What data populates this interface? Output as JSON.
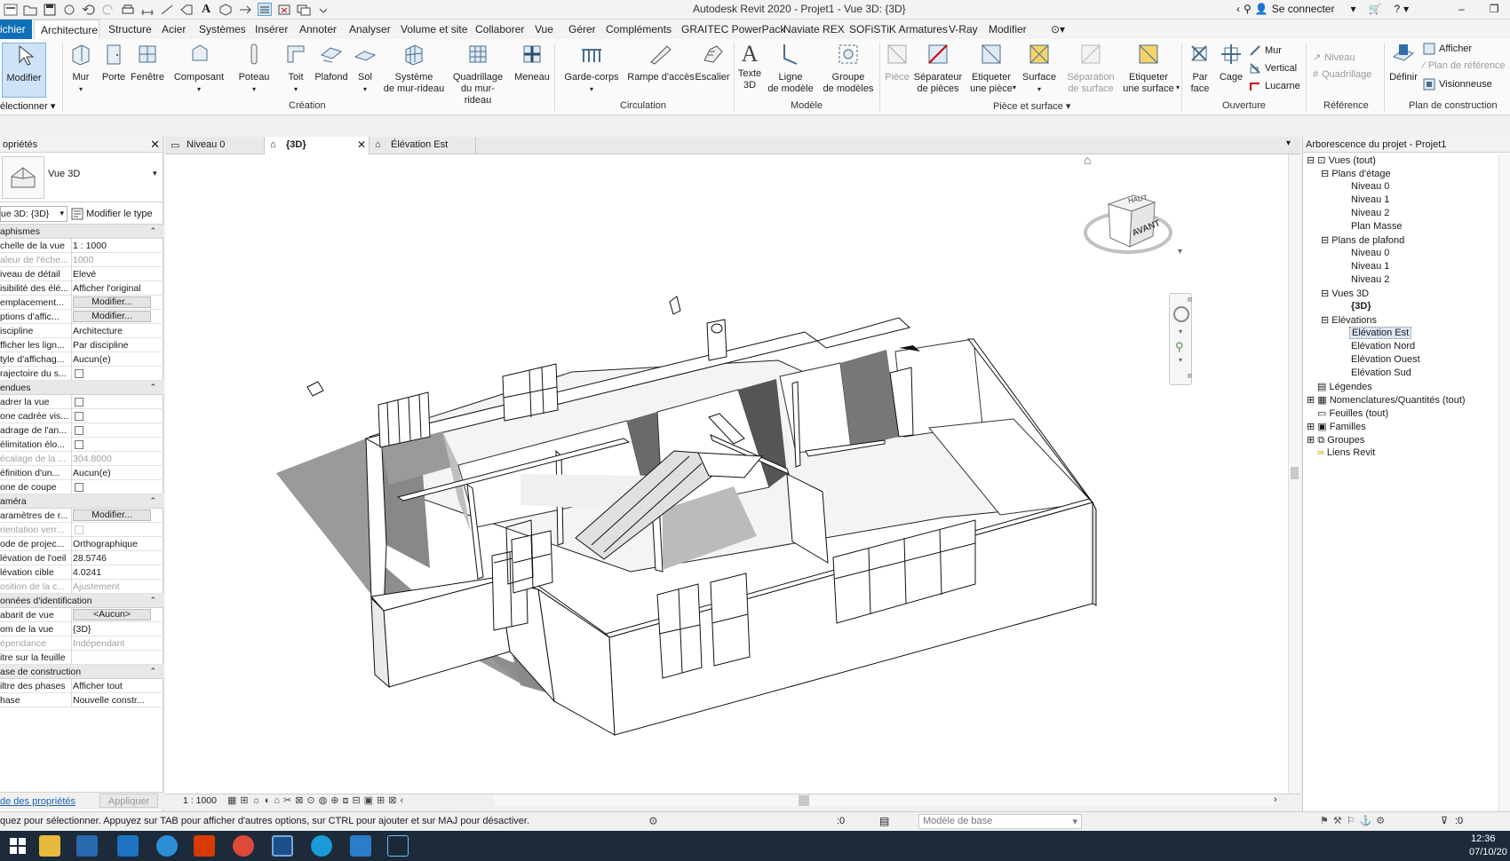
{
  "window": {
    "title": "Autodesk Revit 2020 - Projet1 - Vue 3D: {3D}",
    "connect": "Se connecter"
  },
  "menu": {
    "fichier": "ichier",
    "tabs": [
      "Architecture",
      "Structure",
      "Acier",
      "Systèmes",
      "Insérer",
      "Annoter",
      "Analyser",
      "Volume et site",
      "Collaborer",
      "Vue",
      "Gérer",
      "Compléments",
      "GRAITEC PowerPack",
      "Naviate REX",
      "SOFiSTiK Armatures",
      "V-Ray",
      "Modifier"
    ]
  },
  "ribbon": {
    "modifier": "Modifier",
    "selectionner": "électionner",
    "creation_buttons": [
      "Mur",
      "Porte",
      "Fenêtre",
      "Composant",
      "Poteau",
      "Toit",
      "Plafond",
      "Sol"
    ],
    "systeme_mur": [
      "Système",
      "de mur-rideau"
    ],
    "quadrillage_mur": [
      "Quadrillage",
      "du mur-rideau"
    ],
    "meneau": "Meneau",
    "creation_title": "Création",
    "garde_corps": "Garde-corps",
    "rampe": "Rampe d'accès",
    "escalier": "Escalier",
    "circulation_title": "Circulation",
    "texte3d": [
      "Texte",
      "3D"
    ],
    "ligne_modele": [
      "Ligne",
      "de modèle"
    ],
    "groupe_modeles": [
      "Groupe",
      "de modèles"
    ],
    "modele_title": "Modèle",
    "piece": "Pièce",
    "separateur": [
      "Séparateur",
      "de pièces"
    ],
    "etiq_piece": [
      "Etiqueter",
      "une pièce"
    ],
    "surface": "Surface",
    "sep_surface": [
      "Séparation",
      "de surface"
    ],
    "etiq_surface": [
      "Etiqueter",
      "une surface"
    ],
    "piece_surface_title": "Pièce et surface",
    "par_face": [
      "Par",
      "face"
    ],
    "cage": "Cage",
    "mur_small": "Mur",
    "vertical": "Vertical",
    "lucarne": "Lucarne",
    "ouverture_title": "Ouverture",
    "niveau": "Niveau",
    "quadrillage": "Quadrillage",
    "reference_title": "Référence",
    "definir": "Définir",
    "afficher": "Afficher",
    "plan_ref": "Plan de référence",
    "visionneuse": "Visionneuse",
    "plan_constr_title": "Plan de construction"
  },
  "properties": {
    "title": "opriétés",
    "type_name": "Vue 3D",
    "selector": "ue 3D: {3D}",
    "edit_type": "Modifier le type",
    "apply": "Appliquer",
    "help_link": "de des propriétés",
    "groups": {
      "graphismes": "aphismes",
      "etendues": "endues",
      "camera": "améra",
      "donnees": "onnées d'identification",
      "phase": "ase de construction"
    },
    "rows": {
      "echelle": [
        "chelle de la vue",
        "1 : 1000"
      ],
      "valeur": [
        "aleur de l'éche...",
        "1000"
      ],
      "niveau_detail": [
        "iveau de détail",
        "Elevé"
      ],
      "visibilite": [
        "isibilité des élé...",
        "Afficher l'original"
      ],
      "remplacement": [
        "emplacement...",
        "Modifier..."
      ],
      "options": [
        "ptions d'affic...",
        "Modifier..."
      ],
      "discipline": [
        "iscipline",
        "Architecture"
      ],
      "afficher_lignes": [
        "fficher les lign...",
        "Par discipline"
      ],
      "style": [
        "tyle d'affichag...",
        "Aucun(e)"
      ],
      "trajectoire": [
        "rajectoire du s...",
        ""
      ],
      "cadrer": [
        "adrer la vue",
        ""
      ],
      "zone_cadree": [
        "one cadrée vis...",
        ""
      ],
      "cadrage": [
        "adrage de l'an...",
        ""
      ],
      "delimitation": [
        "élimitation élo...",
        ""
      ],
      "decalage": [
        "écalage de la ...",
        "304.8000"
      ],
      "definition": [
        "éfinition d'un...",
        "Aucun(e)"
      ],
      "zone_coupe": [
        "one de coupe",
        ""
      ],
      "parametres": [
        "aramètres de r...",
        "Modifier..."
      ],
      "orientation": [
        "rientation verr...",
        ""
      ],
      "mode_proj": [
        "ode de projec...",
        "Orthographique"
      ],
      "elev_oeil": [
        "lévation de l'oeil",
        "28.5746"
      ],
      "elev_cible": [
        "lévation cible",
        "4.0241"
      ],
      "position": [
        "osition de la c...",
        "Ajustement"
      ],
      "gabarit": [
        "abarit de vue",
        "<Aucun>"
      ],
      "nom_vue": [
        "om de la vue",
        "{3D}"
      ],
      "dependance": [
        "épendance",
        "Indépendant"
      ],
      "titre_feuille": [
        "itre sur la feuille",
        ""
      ],
      "filtre_phases": [
        "iltre des phases",
        "Afficher tout"
      ],
      "phase": [
        "hase",
        "Nouvelle constr..."
      ]
    }
  },
  "viewtabs": [
    "Niveau 0",
    "{3D}",
    "Élévation Est"
  ],
  "viewcube": {
    "top": "HAUT",
    "front": "AVANT"
  },
  "viewbar": {
    "scale": "1 : 1000"
  },
  "browser": {
    "title": "Arborescence du projet - Projet1",
    "vues": "Vues (tout)",
    "plans_etage": "Plans d'étage",
    "pe_items": [
      "Niveau 0",
      "Niveau 1",
      "Niveau 2",
      "Plan Masse"
    ],
    "plans_plafond": "Plans de plafond",
    "pp_items": [
      "Niveau 0",
      "Niveau 1",
      "Niveau 2"
    ],
    "vues3d": "Vues 3D",
    "v3_items": [
      "{3D}"
    ],
    "elevations": "Elévations",
    "el_items": [
      "Elévation Est",
      "Elévation Nord",
      "Elévation Ouest",
      "Elévation Sud"
    ],
    "others": [
      "Légendes",
      "Nomenclatures/Quantités (tout)",
      "Feuilles (tout)",
      "Familles",
      "Groupes",
      "Liens Revit"
    ]
  },
  "status": {
    "message": "quez pour sélectionner. Appuyez sur TAB pour afficher d'autres options, sur CTRL pour ajouter et sur MAJ pour désactiver.",
    "zero1": ":0",
    "modele": "Modèle de base",
    "zero2": ":0"
  },
  "taskbar": {
    "time": "12:36",
    "date": "07/10/20"
  },
  "colors": {
    "ribbon_blue": "#0e6fb7",
    "selected": "#cde3f7"
  }
}
